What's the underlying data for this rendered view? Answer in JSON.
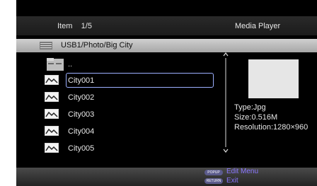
{
  "header": {
    "item_label": "Item",
    "item_counter": "1/5",
    "title": "Media Player"
  },
  "path": "USB1/Photo/Big City",
  "list": {
    "parent_dir": "..",
    "items": [
      "City001",
      "City002",
      "City003",
      "City004",
      "City005"
    ],
    "selected_index": 0
  },
  "info": {
    "type": "Type:Jpg",
    "size": "Size:0.516M",
    "resolution": "Resolution:1280×960"
  },
  "footer": {
    "popup_button": "POPUP",
    "edit_menu": "Edit Menu",
    "return_button": "RETURN",
    "exit": "Exit"
  },
  "colors": {
    "background": "#000000",
    "selection_border": "#9cb0ff",
    "hint_text": "#8a77ff"
  }
}
